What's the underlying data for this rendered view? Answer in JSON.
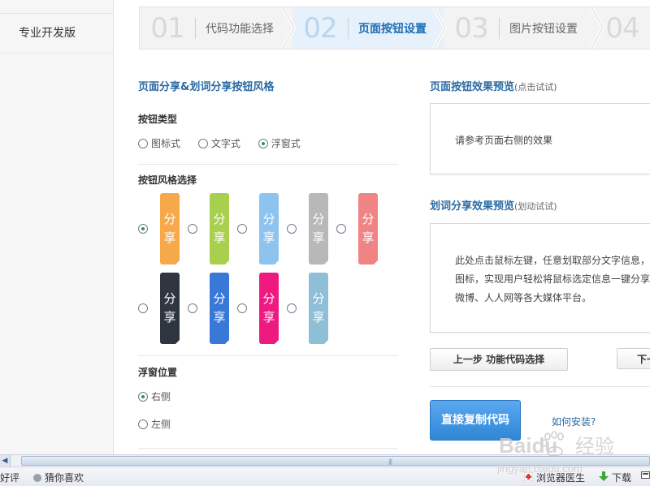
{
  "sidebar": {
    "items": [
      {
        "label": "专业开发版"
      }
    ]
  },
  "steps": [
    {
      "num": "01",
      "label": "代码功能选择"
    },
    {
      "num": "02",
      "label": "页面按钮设置"
    },
    {
      "num": "03",
      "label": "图片按钮设置"
    },
    {
      "num": "04",
      "label": ""
    }
  ],
  "left": {
    "title": "页面分享&划词分享按钮风格",
    "type_title": "按钮类型",
    "type_options": [
      "图标式",
      "文字式",
      "浮窗式"
    ],
    "type_selected": "浮窗式",
    "style_title": "按钮风格选择",
    "style_tab_text": [
      "分",
      "享"
    ],
    "style_colors_row1": [
      "#f7a84a",
      "#a8cf4e",
      "#8cc3ef",
      "#b8b8b8",
      "#f08384"
    ],
    "style_colors_row2": [
      "#2f3640",
      "#3a78d8",
      "#ee1a80",
      "#8fbfd6"
    ],
    "position_title": "浮窗位置",
    "position_options": [
      "右侧",
      "左侧"
    ],
    "position_selected": "右侧"
  },
  "right": {
    "preview_title": "页面按钮效果预览",
    "preview_hint": "(点击试试)",
    "preview_text": "请参考页面右侧的效果",
    "select_title": "划词分享效果预览",
    "select_hint": "(划动试试)",
    "select_lines": [
      "此处点击鼠标左键，任意划取部分文字信息，",
      "图标，实现用户轻松将鼠标选定信息一键分享",
      "微博、人人网等各大媒体平台。"
    ],
    "prev_button": "上一步 功能代码选择",
    "next_button": "下一",
    "copy_button": "直接复制代码",
    "install_link": "如何安装?"
  },
  "statusbar": {
    "left_partial": "好评",
    "like": "猜你喜欢",
    "doctor": "浏览器医生",
    "download": "下载"
  },
  "watermark": {
    "brand": "Baidu",
    "brand_cn": "经验",
    "url": "jingyan.baidu.com"
  }
}
